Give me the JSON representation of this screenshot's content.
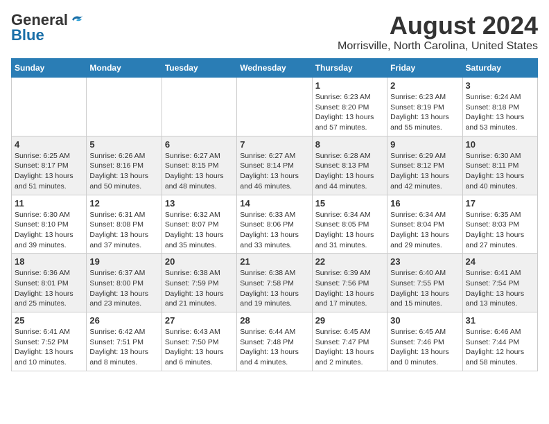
{
  "header": {
    "logo_general": "General",
    "logo_blue": "Blue",
    "main_title": "August 2024",
    "subtitle": "Morrisville, North Carolina, United States"
  },
  "weekdays": [
    "Sunday",
    "Monday",
    "Tuesday",
    "Wednesday",
    "Thursday",
    "Friday",
    "Saturday"
  ],
  "weeks": [
    [
      {
        "day": "",
        "info": ""
      },
      {
        "day": "",
        "info": ""
      },
      {
        "day": "",
        "info": ""
      },
      {
        "day": "",
        "info": ""
      },
      {
        "day": "1",
        "info": "Sunrise: 6:23 AM\nSunset: 8:20 PM\nDaylight: 13 hours\nand 57 minutes."
      },
      {
        "day": "2",
        "info": "Sunrise: 6:23 AM\nSunset: 8:19 PM\nDaylight: 13 hours\nand 55 minutes."
      },
      {
        "day": "3",
        "info": "Sunrise: 6:24 AM\nSunset: 8:18 PM\nDaylight: 13 hours\nand 53 minutes."
      }
    ],
    [
      {
        "day": "4",
        "info": "Sunrise: 6:25 AM\nSunset: 8:17 PM\nDaylight: 13 hours\nand 51 minutes."
      },
      {
        "day": "5",
        "info": "Sunrise: 6:26 AM\nSunset: 8:16 PM\nDaylight: 13 hours\nand 50 minutes."
      },
      {
        "day": "6",
        "info": "Sunrise: 6:27 AM\nSunset: 8:15 PM\nDaylight: 13 hours\nand 48 minutes."
      },
      {
        "day": "7",
        "info": "Sunrise: 6:27 AM\nSunset: 8:14 PM\nDaylight: 13 hours\nand 46 minutes."
      },
      {
        "day": "8",
        "info": "Sunrise: 6:28 AM\nSunset: 8:13 PM\nDaylight: 13 hours\nand 44 minutes."
      },
      {
        "day": "9",
        "info": "Sunrise: 6:29 AM\nSunset: 8:12 PM\nDaylight: 13 hours\nand 42 minutes."
      },
      {
        "day": "10",
        "info": "Sunrise: 6:30 AM\nSunset: 8:11 PM\nDaylight: 13 hours\nand 40 minutes."
      }
    ],
    [
      {
        "day": "11",
        "info": "Sunrise: 6:30 AM\nSunset: 8:10 PM\nDaylight: 13 hours\nand 39 minutes."
      },
      {
        "day": "12",
        "info": "Sunrise: 6:31 AM\nSunset: 8:08 PM\nDaylight: 13 hours\nand 37 minutes."
      },
      {
        "day": "13",
        "info": "Sunrise: 6:32 AM\nSunset: 8:07 PM\nDaylight: 13 hours\nand 35 minutes."
      },
      {
        "day": "14",
        "info": "Sunrise: 6:33 AM\nSunset: 8:06 PM\nDaylight: 13 hours\nand 33 minutes."
      },
      {
        "day": "15",
        "info": "Sunrise: 6:34 AM\nSunset: 8:05 PM\nDaylight: 13 hours\nand 31 minutes."
      },
      {
        "day": "16",
        "info": "Sunrise: 6:34 AM\nSunset: 8:04 PM\nDaylight: 13 hours\nand 29 minutes."
      },
      {
        "day": "17",
        "info": "Sunrise: 6:35 AM\nSunset: 8:03 PM\nDaylight: 13 hours\nand 27 minutes."
      }
    ],
    [
      {
        "day": "18",
        "info": "Sunrise: 6:36 AM\nSunset: 8:01 PM\nDaylight: 13 hours\nand 25 minutes."
      },
      {
        "day": "19",
        "info": "Sunrise: 6:37 AM\nSunset: 8:00 PM\nDaylight: 13 hours\nand 23 minutes."
      },
      {
        "day": "20",
        "info": "Sunrise: 6:38 AM\nSunset: 7:59 PM\nDaylight: 13 hours\nand 21 minutes."
      },
      {
        "day": "21",
        "info": "Sunrise: 6:38 AM\nSunset: 7:58 PM\nDaylight: 13 hours\nand 19 minutes."
      },
      {
        "day": "22",
        "info": "Sunrise: 6:39 AM\nSunset: 7:56 PM\nDaylight: 13 hours\nand 17 minutes."
      },
      {
        "day": "23",
        "info": "Sunrise: 6:40 AM\nSunset: 7:55 PM\nDaylight: 13 hours\nand 15 minutes."
      },
      {
        "day": "24",
        "info": "Sunrise: 6:41 AM\nSunset: 7:54 PM\nDaylight: 13 hours\nand 13 minutes."
      }
    ],
    [
      {
        "day": "25",
        "info": "Sunrise: 6:41 AM\nSunset: 7:52 PM\nDaylight: 13 hours\nand 10 minutes."
      },
      {
        "day": "26",
        "info": "Sunrise: 6:42 AM\nSunset: 7:51 PM\nDaylight: 13 hours\nand 8 minutes."
      },
      {
        "day": "27",
        "info": "Sunrise: 6:43 AM\nSunset: 7:50 PM\nDaylight: 13 hours\nand 6 minutes."
      },
      {
        "day": "28",
        "info": "Sunrise: 6:44 AM\nSunset: 7:48 PM\nDaylight: 13 hours\nand 4 minutes."
      },
      {
        "day": "29",
        "info": "Sunrise: 6:45 AM\nSunset: 7:47 PM\nDaylight: 13 hours\nand 2 minutes."
      },
      {
        "day": "30",
        "info": "Sunrise: 6:45 AM\nSunset: 7:46 PM\nDaylight: 13 hours\nand 0 minutes."
      },
      {
        "day": "31",
        "info": "Sunrise: 6:46 AM\nSunset: 7:44 PM\nDaylight: 12 hours\nand 58 minutes."
      }
    ]
  ]
}
